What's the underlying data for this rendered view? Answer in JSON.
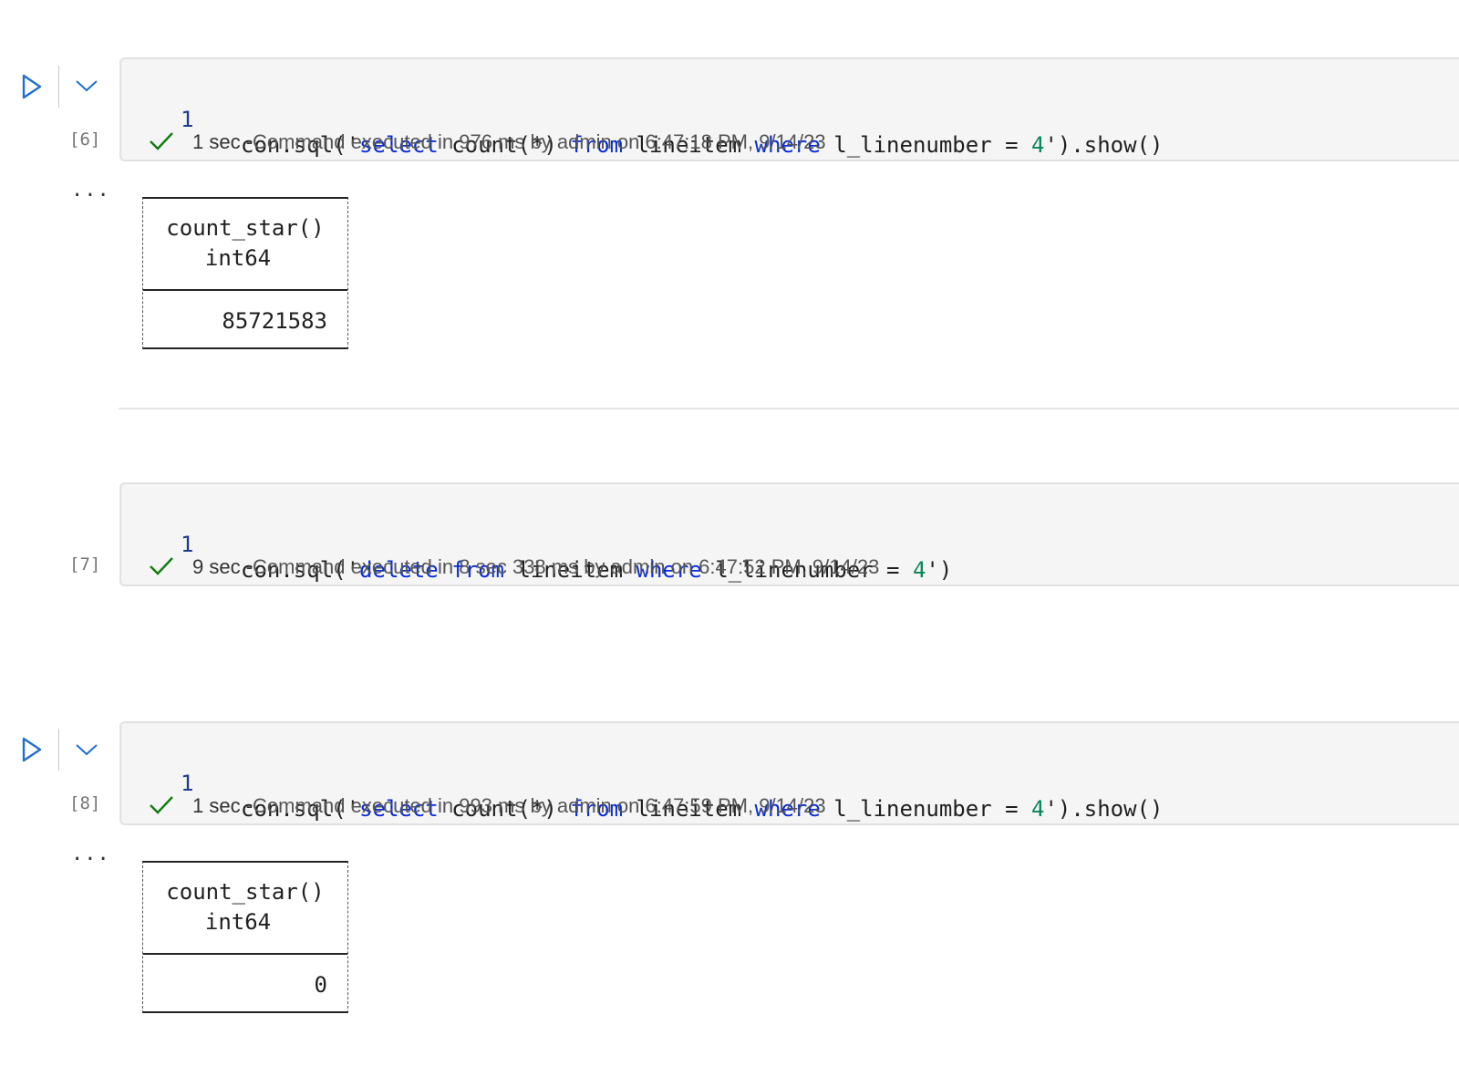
{
  "cells": [
    {
      "exec_count": "[6]",
      "line_number": "1",
      "code": {
        "pre": "con.sql('",
        "kw1": "select",
        "t1": " count(*) ",
        "kw2": "from",
        "t2": " lineitem ",
        "kw3": "where",
        "t3": " l_linenumber = ",
        "num": "4",
        "post": "').show()"
      },
      "status": {
        "duration": "1 sec -",
        "message": "Command executed in 976 ms by admin on 6:47:18 PM, 9/14/23"
      },
      "output": {
        "more": "...",
        "column": "count_star()",
        "type": "int64",
        "value": "85721583"
      }
    },
    {
      "exec_count": "[7]",
      "line_number": "1",
      "code": {
        "pre": "con.sql('",
        "kw1": "delete",
        "t1": " ",
        "kw2": "from",
        "t2": " lineitem ",
        "kw3": "where",
        "t3": " l_linenumber = ",
        "num": "4",
        "post": "')"
      },
      "status": {
        "duration": "9 sec -",
        "message": "Command executed in 8 sec 338 ms by admin on 6:47:52 PM, 9/14/23"
      }
    },
    {
      "exec_count": "[8]",
      "line_number": "1",
      "code": {
        "pre": "con.sql('",
        "kw1": "select",
        "t1": " count(*) ",
        "kw2": "from",
        "t2": " lineitem ",
        "kw3": "where",
        "t3": " l_linenumber = ",
        "num": "4",
        "post": "').show()"
      },
      "status": {
        "duration": "1 sec -",
        "message": "Command executed in 993 ms by admin on 6:47:59 PM, 9/14/23"
      },
      "output": {
        "more": "...",
        "column": "count_star()",
        "type": "int64",
        "value": "0"
      }
    }
  ],
  "icons": {
    "run": "play-icon",
    "collapse": "chevron-down-icon",
    "success": "checkmark-icon"
  },
  "colors": {
    "keyword": "#0b2dd6",
    "number": "#098658",
    "line_number": "#1f3b8f",
    "run_icon": "#1f6fd1",
    "success_check": "#107c10",
    "cell_background": "#f5f5f5"
  }
}
